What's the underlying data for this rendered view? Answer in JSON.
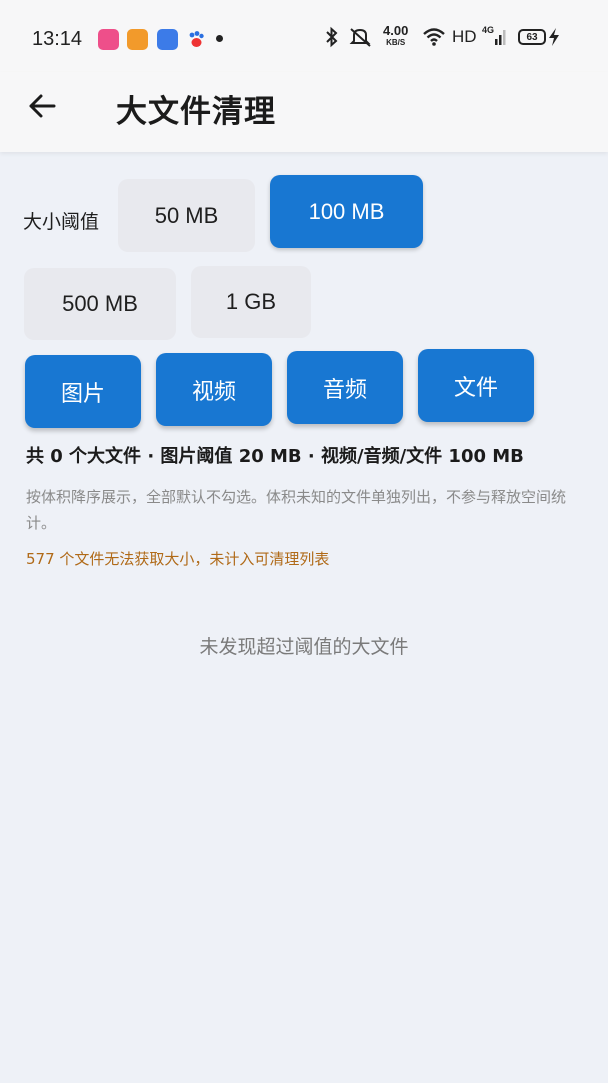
{
  "status_bar": {
    "time": "13:14",
    "network_speed_value": "4.00",
    "network_speed_unit": "KB/S",
    "hd_label": "HD",
    "network_type": "4G",
    "battery_level": "63",
    "icons": [
      "app-icon-1",
      "app-icon-2",
      "app-icon-3",
      "paw-app-icon",
      "bluetooth-icon",
      "mute-icon",
      "wifi-icon",
      "signal-icon",
      "battery-icon",
      "charging-icon"
    ]
  },
  "header": {
    "back_icon": "arrow-left-icon",
    "title": "大文件清理"
  },
  "threshold": {
    "label": "大小阈值",
    "options": [
      {
        "label": "50 MB",
        "selected": false
      },
      {
        "label": "100 MB",
        "selected": true
      },
      {
        "label": "500 MB",
        "selected": false
      },
      {
        "label": "1 GB",
        "selected": false
      }
    ]
  },
  "types": [
    {
      "label": "图片"
    },
    {
      "label": "视频"
    },
    {
      "label": "音频"
    },
    {
      "label": "文件"
    }
  ],
  "summary": "共 0 个大文件 · 图片阈值 20 MB · 视频/音频/文件 100 MB",
  "description": "按体积降序展示，全部默认不勾选。体积未知的文件单独列出，不参与释放空间统计。",
  "warning": "577 个文件无法获取大小，未计入可清理列表",
  "empty_message": "未发现超过阈值的大文件",
  "colors": {
    "accent": "#1877d2",
    "warning": "#b06a18",
    "background": "#eef1f7"
  }
}
